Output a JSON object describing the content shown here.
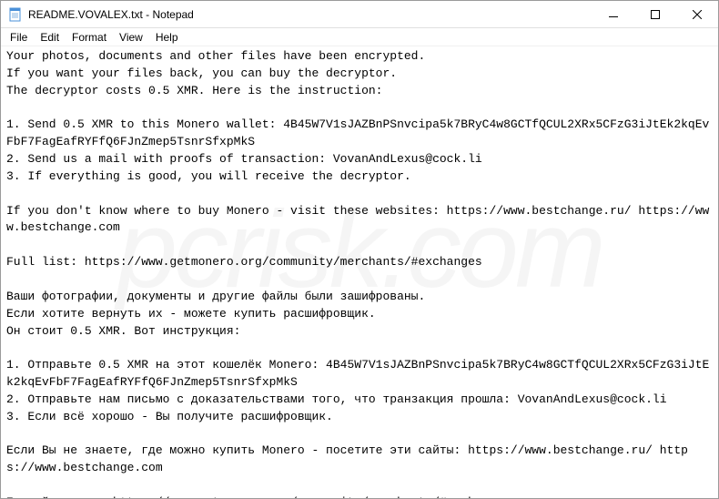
{
  "window": {
    "title": "README.VOVALEX.txt - Notepad"
  },
  "menu": {
    "file": "File",
    "edit": "Edit",
    "format": "Format",
    "view": "View",
    "help": "Help"
  },
  "content": {
    "text": "Your photos, documents and other files have been encrypted.\nIf you want your files back, you can buy the decryptor.\nThe decryptor costs 0.5 XMR. Here is the instruction:\n\n1. Send 0.5 XMR to this Monero wallet: 4B45W7V1sJAZBnPSnvcipa5k7BRyC4w8GCTfQCUL2XRx5CFzG3iJtEk2kqEvFbF7FagEafRYFfQ6FJnZmep5TsnrSfxpMkS\n2. Send us a mail with proofs of transaction: VovanAndLexus@cock.li\n3. If everything is good, you will receive the decryptor.\n\nIf you don't know where to buy Monero - visit these websites: https://www.bestchange.ru/ https://www.bestchange.com\n\nFull list: https://www.getmonero.org/community/merchants/#exchanges\n\nВаши фотографии, документы и другие файлы были зашифрованы.\nЕсли хотите вернуть их - можете купить расшифровщик.\nОн стоит 0.5 XMR. Вот инструкция:\n\n1. Отправьте 0.5 XMR на этот кошелёк Monero: 4B45W7V1sJAZBnPSnvcipa5k7BRyC4w8GCTfQCUL2XRx5CFzG3iJtEk2kqEvFbF7FagEafRYFfQ6FJnZmep5TsnrSfxpMkS\n2. Отправьте нам письмо с доказательствами того, что транзакция прошла: VovanAndLexus@cock.li\n3. Если всё хорошо - Вы получите расшифровщик.\n\nЕсли Вы не знаете, где можно купить Monero - посетите эти сайты: https://www.bestchange.ru/ https://www.bestchange.com\n\nПолный список: https://www.getmonero.org/community/merchants/#exchanges"
  },
  "watermark": "pcrisk.com"
}
